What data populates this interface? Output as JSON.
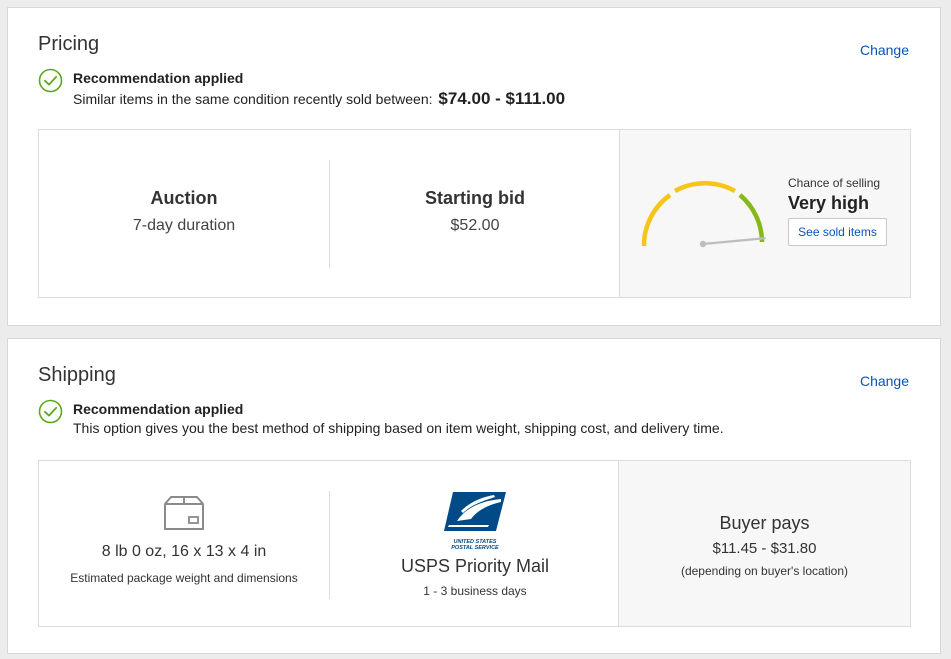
{
  "pricing": {
    "title": "Pricing",
    "change_label": "Change",
    "recommendation": {
      "title": "Recommendation applied",
      "description": "Similar items in the same condition recently sold between:",
      "range": "$74.00 - $111.00"
    },
    "format": {
      "label": "Auction",
      "sub": "7-day duration"
    },
    "starting_bid": {
      "label": "Starting bid",
      "value": "$52.00"
    },
    "chance": {
      "label": "Chance of selling",
      "value": "Very high",
      "level_fraction": 0.97,
      "button_label": "See sold items"
    }
  },
  "shipping": {
    "title": "Shipping",
    "change_label": "Change",
    "recommendation": {
      "title": "Recommendation applied",
      "description": "This option gives you the best method of shipping based on item weight, shipping cost, and delivery time."
    },
    "package": {
      "dimensions": "8 lb 0 oz, 16 x 13 x 4 in",
      "caption": "Estimated package weight and dimensions"
    },
    "service": {
      "logo_text_line1": "UNITED STATES",
      "logo_text_line2": "POSTAL SERVICE",
      "name": "USPS Priority Mail",
      "time": "1 - 3 business days"
    },
    "buyer": {
      "label": "Buyer pays",
      "range": "$11.45 - $31.80",
      "note": "(depending on buyer's location)"
    }
  },
  "colors": {
    "link": "#0654ba",
    "check_green": "#5ba71b",
    "gauge_yellow": "#f5c518",
    "gauge_green": "#86b817",
    "usps_blue": "#004b87"
  }
}
